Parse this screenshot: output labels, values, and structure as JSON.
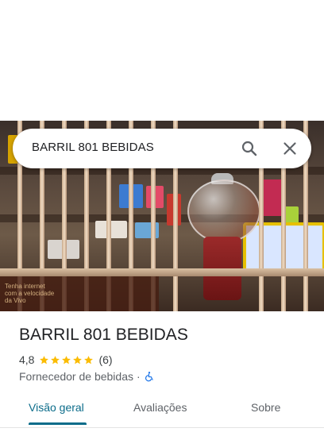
{
  "search": {
    "query": "BARRIL 801 BEBIDAS"
  },
  "place": {
    "name": "BARRIL 801 BEBIDAS",
    "rating": "4,8",
    "stars": 5,
    "review_count": "(6)",
    "category": "Fornecedor de bebidas",
    "separator": "·"
  },
  "photo": {
    "sign_line_1": "Tenha internet",
    "sign_line_2": "com a velocidade",
    "sign_line_3": "da Vivo"
  },
  "tabs": [
    {
      "label": "Visão geral",
      "active": true
    },
    {
      "label": "Avaliações",
      "active": false
    },
    {
      "label": "Sobre",
      "active": false
    }
  ],
  "colors": {
    "accent": "#0b6c8a",
    "star": "#fbbc04",
    "accessibility": "#1a73e8"
  },
  "icons": [
    "search-icon",
    "close-icon",
    "star-icon",
    "wheelchair-accessible-icon"
  ]
}
